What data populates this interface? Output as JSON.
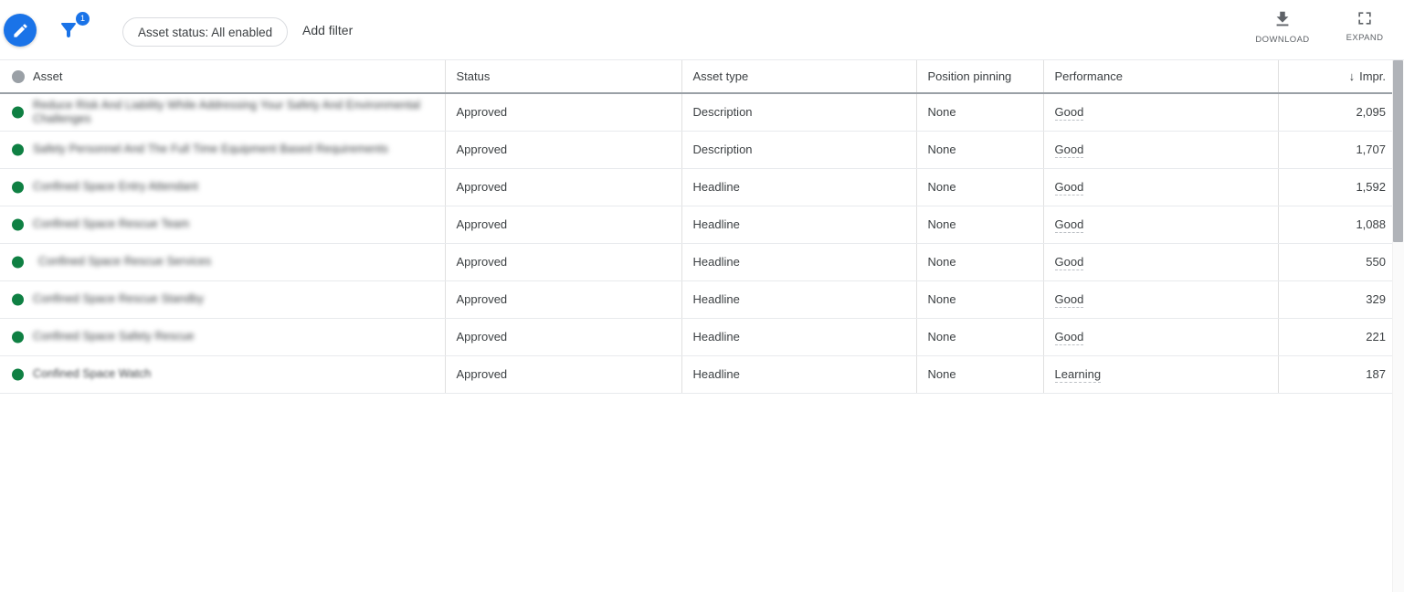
{
  "toolbar": {
    "edit_fab": "edit-pencil",
    "filter_icon": "filter-funnel",
    "filter_badge_count": "1",
    "status_chip_label": "Asset status: All enabled",
    "add_filter_label": "Add filter",
    "download_label": "DOWNLOAD",
    "expand_label": "EXPAND",
    "accent_color": "#1a73e8"
  },
  "table": {
    "columns": [
      {
        "key": "asset",
        "label": "Asset",
        "align": "left"
      },
      {
        "key": "status",
        "label": "Status",
        "align": "left"
      },
      {
        "key": "asset_type",
        "label": "Asset type",
        "align": "left"
      },
      {
        "key": "position_pinning",
        "label": "Position pinning",
        "align": "left"
      },
      {
        "key": "performance",
        "label": "Performance",
        "align": "left"
      },
      {
        "key": "impr",
        "label": "Impr.",
        "align": "right",
        "sort": "descending",
        "sort_glyph": "↓"
      }
    ],
    "status_dot_color": "#0f8043",
    "header_dot_color": "#9aa0a6",
    "rows": [
      {
        "asset": "Reduce Risk And Liability While Addressing Your Safety And Environmental Challenges",
        "redacted": true,
        "status": "Approved",
        "asset_type": "Description",
        "position_pinning": "None",
        "performance": "Good",
        "impr": "2,095"
      },
      {
        "asset": "Safety Personnel And The Full Time Equipment Based Requirements",
        "redacted": true,
        "status": "Approved",
        "asset_type": "Description",
        "position_pinning": "None",
        "performance": "Good",
        "impr": "1,707"
      },
      {
        "asset": "Confined Space Entry Attendant",
        "redacted": true,
        "status": "Approved",
        "asset_type": "Headline",
        "position_pinning": "None",
        "performance": "Good",
        "impr": "1,592"
      },
      {
        "asset": "Confined Space Rescue Team",
        "redacted": true,
        "status": "Approved",
        "asset_type": "Headline",
        "position_pinning": "None",
        "performance": "Good",
        "impr": "1,088"
      },
      {
        "asset": "Confined Space Rescue Services",
        "redacted": true,
        "status": "Approved",
        "asset_type": "Headline",
        "position_pinning": "None",
        "performance": "Good",
        "impr": "550"
      },
      {
        "asset": "Confined Space Rescue Standby",
        "redacted": true,
        "status": "Approved",
        "asset_type": "Headline",
        "position_pinning": "None",
        "performance": "Good",
        "impr": "329"
      },
      {
        "asset": "Confined Space Safety Rescue",
        "redacted": true,
        "status": "Approved",
        "asset_type": "Headline",
        "position_pinning": "None",
        "performance": "Good",
        "impr": "221"
      },
      {
        "asset": "Confined Space Watch",
        "redacted": true,
        "status": "Approved",
        "asset_type": "Headline",
        "position_pinning": "None",
        "performance": "Learning",
        "impr": "187"
      }
    ]
  },
  "scrollbar": {
    "orientation": "vertical",
    "thumb_top": 0,
    "thumb_height": 199
  }
}
